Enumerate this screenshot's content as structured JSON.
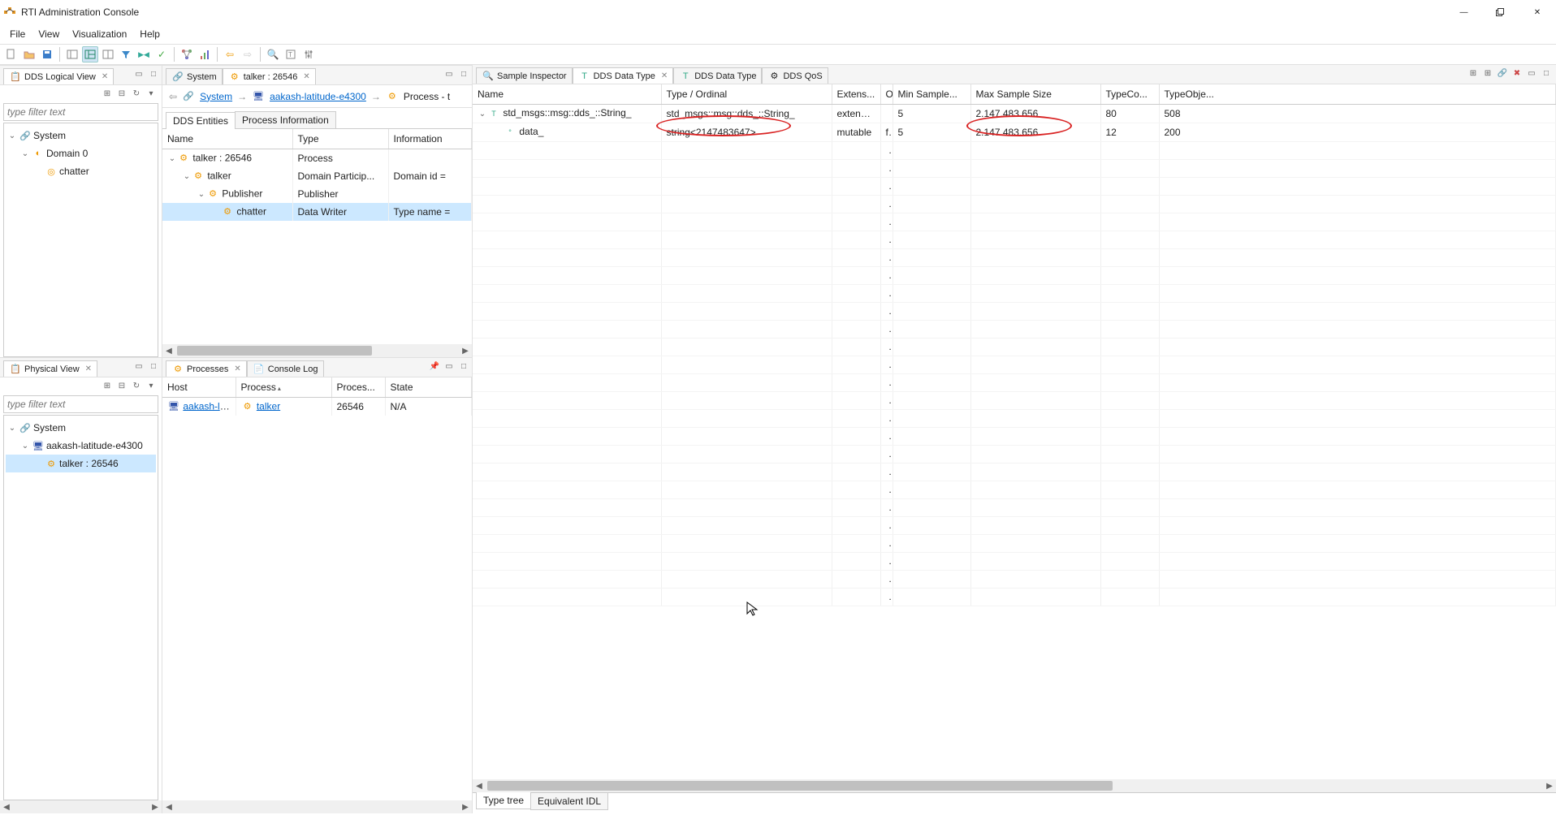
{
  "window": {
    "title": "RTI Administration Console",
    "minimize": "—",
    "maximize": "▢",
    "close": "✕"
  },
  "menu": {
    "items": [
      "File",
      "View",
      "Visualization",
      "Help"
    ]
  },
  "left": {
    "logical_view_title": "DDS Logical View",
    "physical_view_title": "Physical View",
    "filter_placeholder": "type filter text",
    "logical_tree": {
      "system": "System",
      "domain": "Domain 0",
      "chatter": "chatter"
    },
    "physical_tree": {
      "system": "System",
      "host": "aakash-latitude-e4300",
      "process": "talker : 26546"
    }
  },
  "mid": {
    "tab_system": "System",
    "tab_talker": "talker : 26546",
    "breadcrumb": {
      "system": "System",
      "host": "aakash-latitude-e4300",
      "process": "Process - t"
    },
    "subtab_entities": "DDS Entities",
    "subtab_process": "Process Information",
    "entities_headers": {
      "name": "Name",
      "type": "Type",
      "info": "Information"
    },
    "entities_rows": [
      {
        "indent": 0,
        "name": "talker : 26546",
        "type": "Process",
        "info": "",
        "expanded": true,
        "icon": "process-icon"
      },
      {
        "indent": 1,
        "name": "talker",
        "type": "Domain Particip...",
        "info": "Domain id =",
        "expanded": true,
        "icon": "participant-icon"
      },
      {
        "indent": 2,
        "name": "Publisher",
        "type": "Publisher",
        "info": "",
        "expanded": true,
        "icon": "publisher-icon"
      },
      {
        "indent": 3,
        "name": "chatter",
        "type": "Data Writer",
        "info": "Type name =",
        "sel": true,
        "icon": "writer-icon"
      }
    ],
    "processes_title": "Processes",
    "console_log_title": "Console Log",
    "proc_headers": {
      "host": "Host",
      "process": "Process",
      "pid": "Proces...",
      "state": "State"
    },
    "proc_rows": [
      {
        "host": "aakash-latitu",
        "process": "talker",
        "pid": "26546",
        "state": "N/A"
      }
    ]
  },
  "right": {
    "tab_sample": "Sample Inspector",
    "tab_type1": "DDS Data Type",
    "tab_type2": "DDS Data Type",
    "tab_qos": "DDS QoS",
    "headers": {
      "name": "Name",
      "type": "Type / Ordinal",
      "ext": "Extens...",
      "o": "O",
      "min": "Min Sample...",
      "max": "Max Sample Size",
      "tc": "TypeCo...",
      "to": "TypeObje..."
    },
    "rows": [
      {
        "indent": 0,
        "name": "std_msgs::msg::dds_::String_",
        "type": "std_msgs::msg::dds_::String_",
        "ext": "extensi...",
        "o": "",
        "min": "5",
        "max": "2.147.483.656",
        "tc": "80",
        "to": "508",
        "expanded": true,
        "icon": "struct-icon"
      },
      {
        "indent": 1,
        "name": "data_",
        "type": "string<2147483647>",
        "ext": "mutable",
        "o": "f..",
        "min": "5",
        "max": "2.147.483.656",
        "tc": "12",
        "to": "200",
        "icon": "field-icon"
      }
    ],
    "footer_tab1": "Type tree",
    "footer_tab2": "Equivalent IDL"
  }
}
